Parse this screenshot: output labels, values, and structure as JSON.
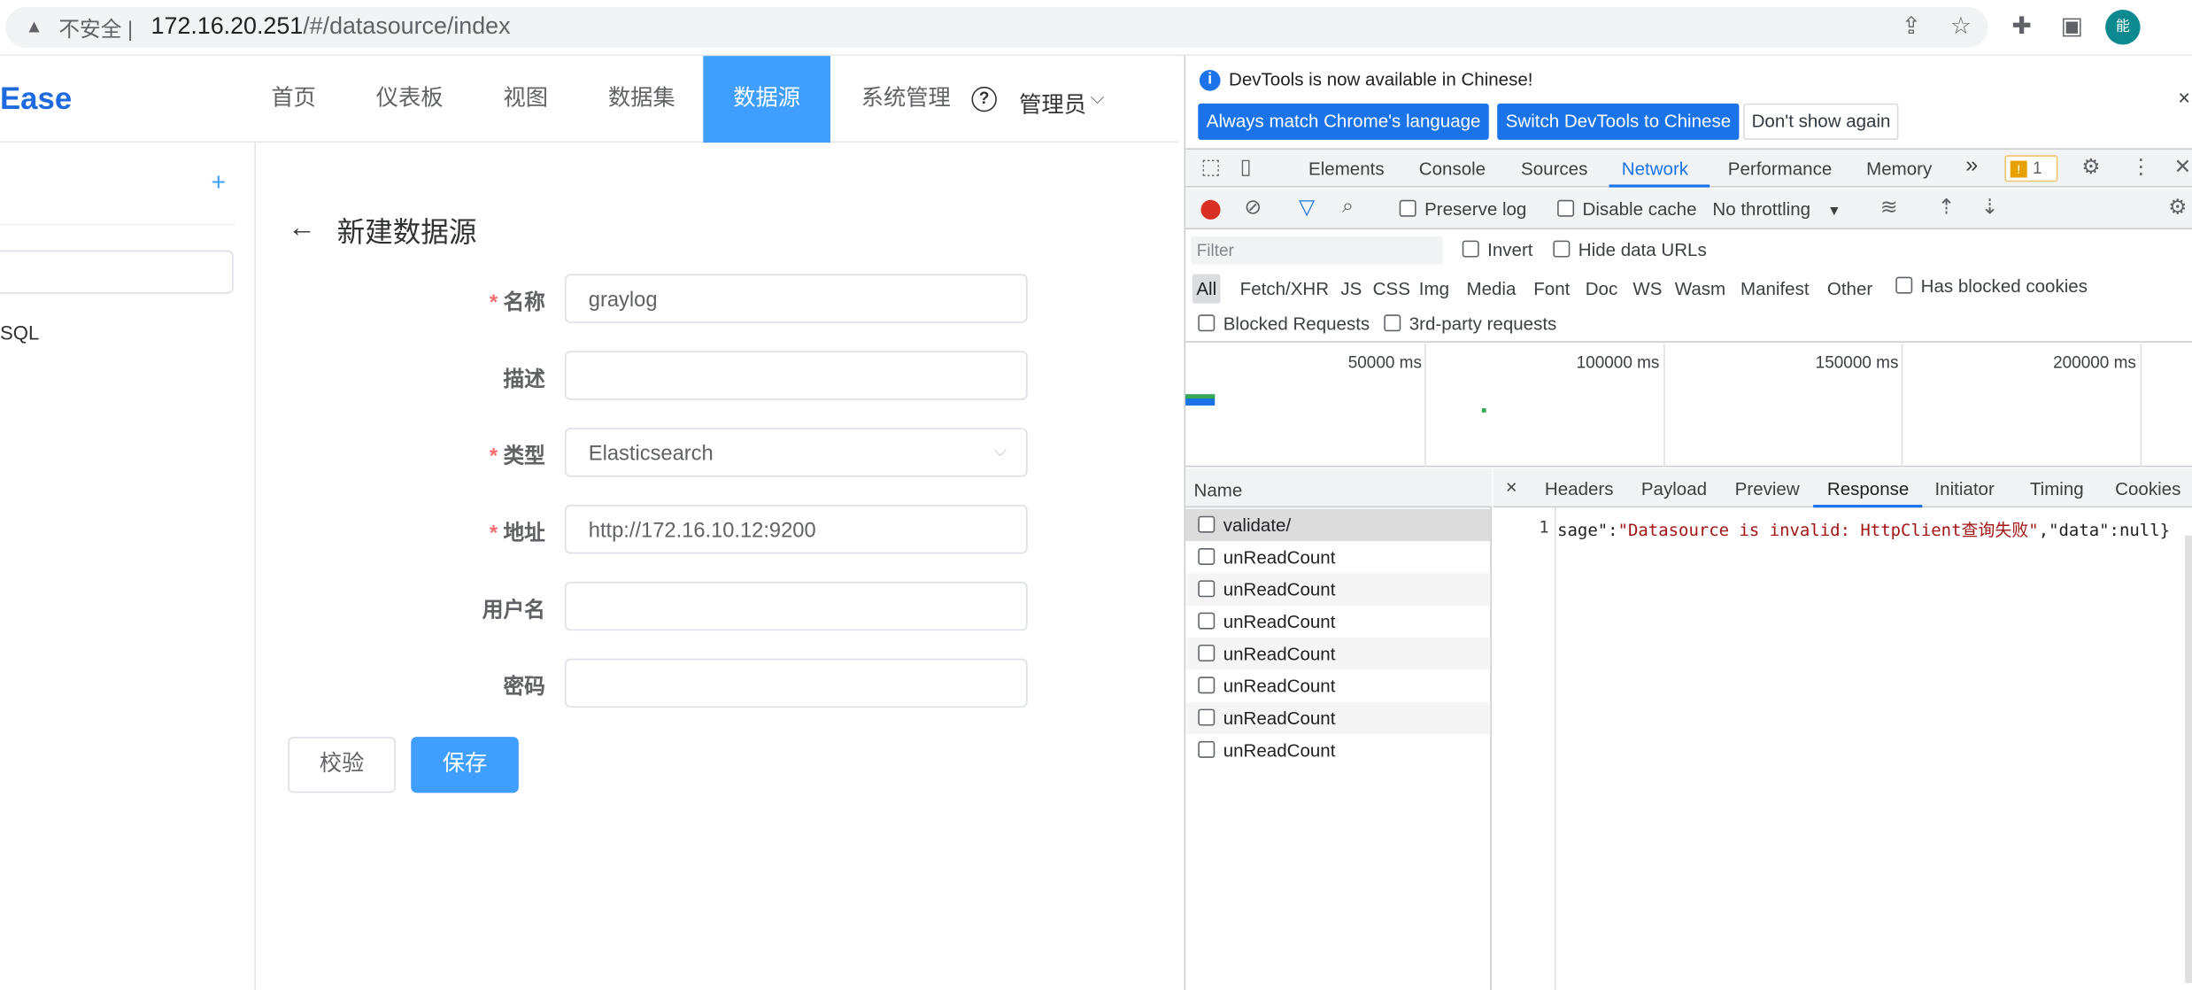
{
  "browser": {
    "insecure_label": "不安全 |",
    "url_host": "172.16.20.251",
    "url_path": "/#/datasource/index",
    "avatar_text": "能"
  },
  "app": {
    "logo_text": "Ease",
    "nav": [
      "首页",
      "仪表板",
      "视图",
      "数据集",
      "数据源",
      "系统管理"
    ],
    "active_nav": "数据源",
    "help_icon": "?",
    "user_name": "管理员",
    "left_item": "SQL",
    "form": {
      "back_arrow": "←",
      "title": "新建数据源",
      "required_mark": "*",
      "fields": [
        {
          "label": "名称",
          "required": true,
          "value": "graylog"
        },
        {
          "label": "描述",
          "required": false,
          "value": ""
        },
        {
          "label": "类型",
          "required": true,
          "value": "Elasticsearch"
        },
        {
          "label": "地址",
          "required": true,
          "value": "http://172.16.10.12:9200"
        },
        {
          "label": "用户名",
          "required": false,
          "value": ""
        },
        {
          "label": "密码",
          "required": false,
          "value": ""
        }
      ],
      "validate_button": "校验",
      "save_button": "保存"
    }
  },
  "devtools": {
    "banner_text": "DevTools is now available in Chinese!",
    "banner_buttons": [
      "Always match Chrome's language",
      "Switch DevTools to Chinese",
      "Don't show again"
    ],
    "banner_close": "×",
    "tabs": [
      "Elements",
      "Console",
      "Sources",
      "Network",
      "Performance",
      "Memory"
    ],
    "active_tab": "Network",
    "more_tabs": "»",
    "warning_count": "1",
    "network_toolbar": {
      "preserve_log": "Preserve log",
      "disable_cache": "Disable cache",
      "throttling": "No throttling"
    },
    "filter": {
      "placeholder": "Filter",
      "invert": "Invert",
      "hide_data_urls": "Hide data URLs",
      "types": [
        "All",
        "Fetch/XHR",
        "JS",
        "CSS",
        "Img",
        "Media",
        "Font",
        "Doc",
        "WS",
        "Wasm",
        "Manifest",
        "Other"
      ],
      "has_blocked_cookies": "Has blocked cookies",
      "blocked_requests": "Blocked Requests",
      "third_party": "3rd-party requests"
    },
    "timeline_labels": [
      "50000 ms",
      "100000 ms",
      "150000 ms",
      "200000 ms"
    ],
    "name_header": "Name",
    "requests": [
      "validate/",
      "unReadCount",
      "unReadCount",
      "unReadCount",
      "unReadCount",
      "unReadCount",
      "unReadCount",
      "unReadCount"
    ],
    "detail_tabs": [
      "Headers",
      "Payload",
      "Preview",
      "Response",
      "Initiator",
      "Timing",
      "Cookies"
    ],
    "active_detail_tab": "Response",
    "detail_close": "×",
    "response_line_number": "1",
    "response_text_prefix": "sage\":",
    "response_text_string": "\"Datasource is invalid: HttpClient查询失败\"",
    "response_text_suffix": ",\"data\":null}"
  }
}
